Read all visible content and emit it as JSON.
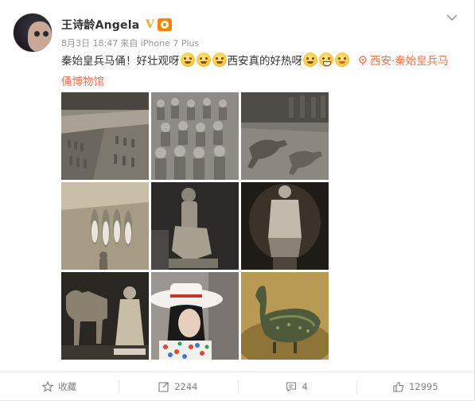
{
  "user": {
    "name": "王诗龄Angela",
    "verified_mark": "V"
  },
  "post": {
    "timestamp": "8月3日 18:47",
    "source": "来自 iPhone 7 Plus",
    "text_line1_a": "秦始皇兵马俑！好壮观呀",
    "text_line1_b": "西安真的好热呀",
    "location": "西安·秦始皇兵马俑博物馆",
    "emojis_1": [
      "sweat-face-icon",
      "sweat-face-icon",
      "sweat-face-icon"
    ],
    "emojis_2": [
      "hot-face-icon",
      "grin-face-icon",
      "tongue-face-icon"
    ]
  },
  "images": [
    {
      "name": "terracotta-pits-overview"
    },
    {
      "name": "terracotta-warriors-rows"
    },
    {
      "name": "terracotta-horses-excavation"
    },
    {
      "name": "excavation-site-figures"
    },
    {
      "name": "kneeling-archer-statue"
    },
    {
      "name": "warrior-statue-display"
    },
    {
      "name": "horse-and-warrior-statue"
    },
    {
      "name": "girl-in-white-hat"
    },
    {
      "name": "bronze-crane-artifact"
    }
  ],
  "toolbar": {
    "favorite_label": "收藏",
    "repost_count": "2244",
    "comment_count": "4",
    "like_count": "12995"
  },
  "colors": {
    "location": "#eb7350",
    "muted": "#808080",
    "badge": "#ff8200",
    "verified": "#f6a623"
  }
}
